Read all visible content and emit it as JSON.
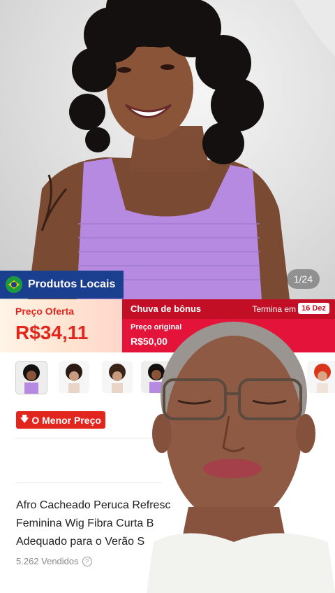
{
  "product": {
    "image_counter": "1/24",
    "local_badge": "Produtos Locais",
    "offer_label": "Preço Oferta",
    "offer_price": "R$34,11",
    "bonus_label": "Chuva de bônus",
    "ends_label": "Termina em",
    "ends_date": "16 Dez",
    "original_label": "Preço original",
    "original_price": "R$50,00",
    "lowest_price_badge": "O Menor Preço",
    "title_lines": [
      "Afro Cacheado Peruca Refresc",
      "Feminina Wig Fibra Curta B",
      "Adequado para o Verão S"
    ],
    "sold": "5.262 Vendidos"
  },
  "colors": {
    "accent_red": "#e3261d",
    "badge_blue": "#1b3f8f",
    "promo_band": "#e3133a"
  },
  "icons": [
    "brazil-flag-icon",
    "down-arrow-icon",
    "help-icon"
  ]
}
